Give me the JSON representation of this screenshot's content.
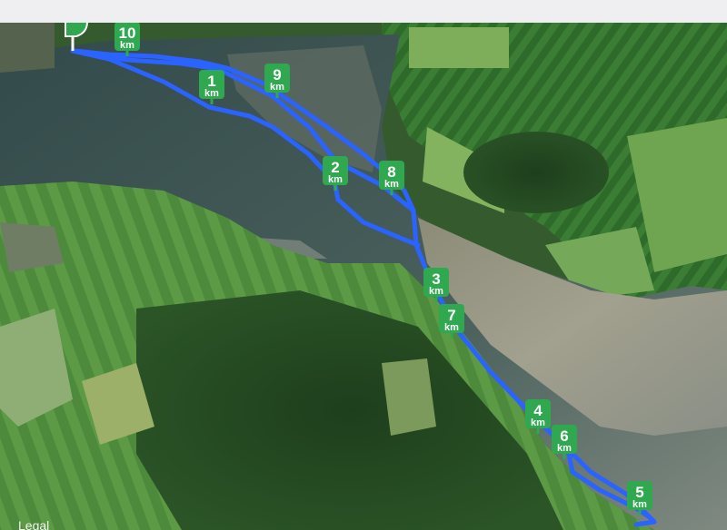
{
  "map": {
    "legal_label": "Legal",
    "route_color": "#2a63ff",
    "marker_color": "#2fa84f",
    "start_flag_color": "#2fa84f"
  },
  "km_markers": [
    {
      "number": "10",
      "unit": "km"
    },
    {
      "number": "1",
      "unit": "km"
    },
    {
      "number": "9",
      "unit": "km"
    },
    {
      "number": "2",
      "unit": "km"
    },
    {
      "number": "8",
      "unit": "km"
    },
    {
      "number": "3",
      "unit": "km"
    },
    {
      "number": "7",
      "unit": "km"
    },
    {
      "number": "4",
      "unit": "km"
    },
    {
      "number": "6",
      "unit": "km"
    },
    {
      "number": "5",
      "unit": "km"
    }
  ]
}
